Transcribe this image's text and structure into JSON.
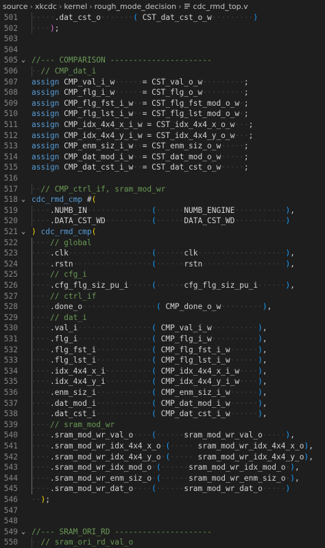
{
  "breadcrumbs": [
    "source",
    "xkcdc",
    "kernel",
    "rough_mode_decision",
    "cdc_rmd_top.v"
  ],
  "colors": {
    "background": "#1e1e1e",
    "keyword": "#569cd6",
    "comment": "#6a9955",
    "line_number": "#858585",
    "bracket_gold": "#ffd700",
    "bracket_purple": "#da70d6",
    "bracket_blue": "#179fff"
  },
  "lines": [
    {
      "n": "501",
      "fold": "",
      "tokens": [
        [
          "ws",
          "·····"
        ],
        [
          "pn",
          ".dat_cst_o"
        ],
        [
          "ws",
          "·······"
        ],
        [
          "br3",
          "("
        ],
        [
          "pn",
          " CST_dat_cst_o_w"
        ],
        [
          "ws",
          "·········"
        ],
        [
          "br3",
          ")"
        ]
      ]
    },
    {
      "n": "502",
      "fold": "",
      "tokens": [
        [
          "ws",
          "····"
        ],
        [
          "br2",
          ")"
        ],
        [
          "pn",
          ";"
        ]
      ]
    },
    {
      "n": "503",
      "fold": "",
      "tokens": []
    },
    {
      "n": "504",
      "fold": "",
      "tokens": []
    },
    {
      "n": "505",
      "fold": "⌄",
      "tokens": [
        [
          "cm",
          "//--- COMPARISON ----------------------"
        ]
      ]
    },
    {
      "n": "506",
      "fold": "",
      "tokens": [
        [
          "ws",
          "··"
        ],
        [
          "cm",
          "// CMP_dat_i"
        ]
      ]
    },
    {
      "n": "507",
      "fold": "",
      "tokens": [
        [
          "kw",
          "assign"
        ],
        [
          "pn",
          " CMP_val_i_w"
        ],
        [
          "ws",
          "······"
        ],
        [
          "pn",
          "= CST_val_o_w"
        ],
        [
          "ws",
          "·········"
        ],
        [
          "pn",
          ";"
        ]
      ]
    },
    {
      "n": "508",
      "fold": "",
      "tokens": [
        [
          "kw",
          "assign"
        ],
        [
          "pn",
          " CMP_flg_i_w"
        ],
        [
          "ws",
          "······"
        ],
        [
          "pn",
          "= CST_flg_o_w"
        ],
        [
          "ws",
          "·········"
        ],
        [
          "pn",
          ";"
        ]
      ]
    },
    {
      "n": "509",
      "fold": "",
      "tokens": [
        [
          "kw",
          "assign"
        ],
        [
          "pn",
          " CMP_flg_fst_i_w"
        ],
        [
          "ws",
          "··"
        ],
        [
          "pn",
          "= CST_flg_fst_mod_o_w"
        ],
        [
          "ws",
          "·"
        ],
        [
          "pn",
          ";"
        ]
      ]
    },
    {
      "n": "510",
      "fold": "",
      "tokens": [
        [
          "kw",
          "assign"
        ],
        [
          "pn",
          " CMP_flg_lst_i_w"
        ],
        [
          "ws",
          "··"
        ],
        [
          "pn",
          "= CST_flg_lst_mod_o_w"
        ],
        [
          "ws",
          "·"
        ],
        [
          "pn",
          ";"
        ]
      ]
    },
    {
      "n": "511",
      "fold": "",
      "tokens": [
        [
          "kw",
          "assign"
        ],
        [
          "pn",
          " CMP_idx_4x4_x_i_w"
        ],
        [
          "pn",
          " = CST_idx_4x4_x_o_w"
        ],
        [
          "ws",
          "···"
        ],
        [
          "pn",
          ";"
        ]
      ]
    },
    {
      "n": "512",
      "fold": "",
      "tokens": [
        [
          "kw",
          "assign"
        ],
        [
          "pn",
          " CMP_idx_4x4_y_i_w"
        ],
        [
          "pn",
          " = CST_idx_4x4_y_o_w"
        ],
        [
          "ws",
          "···"
        ],
        [
          "pn",
          ";"
        ]
      ]
    },
    {
      "n": "513",
      "fold": "",
      "tokens": [
        [
          "kw",
          "assign"
        ],
        [
          "pn",
          " CMP_enm_siz_i_w"
        ],
        [
          "ws",
          "··"
        ],
        [
          "pn",
          "= CST_enm_siz_o_w"
        ],
        [
          "ws",
          "·····"
        ],
        [
          "pn",
          ";"
        ]
      ]
    },
    {
      "n": "514",
      "fold": "",
      "tokens": [
        [
          "kw",
          "assign"
        ],
        [
          "pn",
          " CMP_dat_mod_i_w"
        ],
        [
          "ws",
          "··"
        ],
        [
          "pn",
          "= CST_dat_mod_o_w"
        ],
        [
          "ws",
          "·····"
        ],
        [
          "pn",
          ";"
        ]
      ]
    },
    {
      "n": "515",
      "fold": "",
      "tokens": [
        [
          "kw",
          "assign"
        ],
        [
          "pn",
          " CMP_dat_cst_i_w"
        ],
        [
          "ws",
          "··"
        ],
        [
          "pn",
          "= CST_dat_cst_o_w"
        ],
        [
          "ws",
          "·····"
        ],
        [
          "pn",
          ";"
        ]
      ]
    },
    {
      "n": "516",
      "fold": "",
      "tokens": []
    },
    {
      "n": "517",
      "fold": "",
      "tokens": [
        [
          "ws",
          "··"
        ],
        [
          "cm",
          "// CMP_ctrl_if, sram_mod_wr"
        ]
      ]
    },
    {
      "n": "518",
      "fold": "⌄",
      "tokens": [
        [
          "kw",
          "cdc_rmd_cmp"
        ],
        [
          "pn",
          " #"
        ],
        [
          "br",
          "("
        ]
      ]
    },
    {
      "n": "519",
      "fold": "",
      "tokens": [
        [
          "ws",
          "····"
        ],
        [
          "pn",
          ".NUMB_IN"
        ],
        [
          "ws",
          "··············"
        ],
        [
          "br3",
          "("
        ],
        [
          "ws",
          "······"
        ],
        [
          "pn",
          "NUMB_ENGINE"
        ],
        [
          "ws",
          "···········"
        ],
        [
          "br3",
          ")"
        ],
        [
          "pn",
          ","
        ]
      ]
    },
    {
      "n": "520",
      "fold": "",
      "tokens": [
        [
          "ws",
          "····"
        ],
        [
          "pn",
          ".DATA_CST_WD"
        ],
        [
          "ws",
          "··········"
        ],
        [
          "br3",
          "("
        ],
        [
          "ws",
          "······"
        ],
        [
          "pn",
          "DATA_CST_WD"
        ],
        [
          "ws",
          "···········"
        ],
        [
          "br3",
          ")"
        ]
      ]
    },
    {
      "n": "521",
      "fold": "⌄",
      "tokens": [
        [
          "br",
          ")"
        ],
        [
          "kw",
          " cdc_rmd_cmp"
        ],
        [
          "br",
          "("
        ]
      ]
    },
    {
      "n": "522",
      "fold": "",
      "tokens": [
        [
          "ws",
          "····"
        ],
        [
          "cm",
          "// global"
        ]
      ]
    },
    {
      "n": "523",
      "fold": "",
      "tokens": [
        [
          "ws",
          "····"
        ],
        [
          "pn",
          ".clk"
        ],
        [
          "ws",
          "··················"
        ],
        [
          "br3",
          "("
        ],
        [
          "ws",
          "······"
        ],
        [
          "pn",
          "clk"
        ],
        [
          "ws",
          "···················"
        ],
        [
          "br3",
          ")"
        ],
        [
          "pn",
          ","
        ]
      ]
    },
    {
      "n": "524",
      "fold": "",
      "tokens": [
        [
          "ws",
          "····"
        ],
        [
          "pn",
          ".rstn"
        ],
        [
          "ws",
          "·················"
        ],
        [
          "br3",
          "("
        ],
        [
          "ws",
          "······"
        ],
        [
          "pn",
          "rstn"
        ],
        [
          "ws",
          "··················"
        ],
        [
          "br3",
          ")"
        ],
        [
          "pn",
          ","
        ]
      ]
    },
    {
      "n": "525",
      "fold": "",
      "tokens": [
        [
          "ws",
          "····"
        ],
        [
          "cm",
          "// cfg_i"
        ]
      ]
    },
    {
      "n": "526",
      "fold": "",
      "tokens": [
        [
          "ws",
          "····"
        ],
        [
          "pn",
          ".cfg_flg_siz_pu_i"
        ],
        [
          "ws",
          "·····"
        ],
        [
          "br3",
          "("
        ],
        [
          "ws",
          "······"
        ],
        [
          "pn",
          "cfg_flg_siz_pu_i"
        ],
        [
          "ws",
          "······"
        ],
        [
          "br3",
          ")"
        ],
        [
          "pn",
          ","
        ]
      ]
    },
    {
      "n": "527",
      "fold": "",
      "tokens": [
        [
          "ws",
          "····"
        ],
        [
          "cm",
          "// ctrl_if"
        ]
      ]
    },
    {
      "n": "528",
      "fold": "",
      "tokens": [
        [
          "ws",
          "····"
        ],
        [
          "pn",
          ".done_o"
        ],
        [
          "ws",
          "················"
        ],
        [
          "br3",
          "("
        ],
        [
          "pn",
          " CMP_done_o_w"
        ],
        [
          "ws",
          "·········"
        ],
        [
          "br3",
          ")"
        ],
        [
          "pn",
          ","
        ]
      ]
    },
    {
      "n": "529",
      "fold": "",
      "tokens": [
        [
          "ws",
          "····"
        ],
        [
          "cm",
          "// dat_i"
        ]
      ]
    },
    {
      "n": "530",
      "fold": "",
      "tokens": [
        [
          "ws",
          "····"
        ],
        [
          "pn",
          ".val_i"
        ],
        [
          "ws",
          "················"
        ],
        [
          "br3",
          "("
        ],
        [
          "pn",
          " CMP_val_i_w"
        ],
        [
          "ws",
          "··········"
        ],
        [
          "br3",
          ")"
        ],
        [
          "pn",
          ","
        ]
      ]
    },
    {
      "n": "531",
      "fold": "",
      "tokens": [
        [
          "ws",
          "····"
        ],
        [
          "pn",
          ".flg_i"
        ],
        [
          "ws",
          "················"
        ],
        [
          "br3",
          "("
        ],
        [
          "pn",
          " CMP_flg_i_w"
        ],
        [
          "ws",
          "··········"
        ],
        [
          "br3",
          ")"
        ],
        [
          "pn",
          ","
        ]
      ]
    },
    {
      "n": "532",
      "fold": "",
      "tokens": [
        [
          "ws",
          "····"
        ],
        [
          "pn",
          ".flg_fst_i"
        ],
        [
          "ws",
          "············"
        ],
        [
          "br3",
          "("
        ],
        [
          "pn",
          " CMP_flg_fst_i_w"
        ],
        [
          "ws",
          "······"
        ],
        [
          "br3",
          ")"
        ],
        [
          "pn",
          ","
        ]
      ]
    },
    {
      "n": "533",
      "fold": "",
      "tokens": [
        [
          "ws",
          "····"
        ],
        [
          "pn",
          ".flg_lst_i"
        ],
        [
          "ws",
          "············"
        ],
        [
          "br3",
          "("
        ],
        [
          "pn",
          " CMP_flg_lst_i_w"
        ],
        [
          "ws",
          "······"
        ],
        [
          "br3",
          ")"
        ],
        [
          "pn",
          ","
        ]
      ]
    },
    {
      "n": "534",
      "fold": "",
      "tokens": [
        [
          "ws",
          "····"
        ],
        [
          "pn",
          ".idx_4x4_x_i"
        ],
        [
          "ws",
          "··········"
        ],
        [
          "br3",
          "("
        ],
        [
          "pn",
          " CMP_idx_4x4_x_i_w"
        ],
        [
          "ws",
          "····"
        ],
        [
          "br3",
          ")"
        ],
        [
          "pn",
          ","
        ]
      ]
    },
    {
      "n": "535",
      "fold": "",
      "tokens": [
        [
          "ws",
          "····"
        ],
        [
          "pn",
          ".idx_4x4_y_i"
        ],
        [
          "ws",
          "··········"
        ],
        [
          "br3",
          "("
        ],
        [
          "pn",
          " CMP_idx_4x4_y_i_w"
        ],
        [
          "ws",
          "····"
        ],
        [
          "br3",
          ")"
        ],
        [
          "pn",
          ","
        ]
      ]
    },
    {
      "n": "536",
      "fold": "",
      "tokens": [
        [
          "ws",
          "····"
        ],
        [
          "pn",
          ".enm_siz_i"
        ],
        [
          "ws",
          "············"
        ],
        [
          "br3",
          "("
        ],
        [
          "pn",
          " CMP_enm_siz_i_w"
        ],
        [
          "ws",
          "······"
        ],
        [
          "br3",
          ")"
        ],
        [
          "pn",
          ","
        ]
      ]
    },
    {
      "n": "537",
      "fold": "",
      "tokens": [
        [
          "ws",
          "····"
        ],
        [
          "pn",
          ".dat_mod_i"
        ],
        [
          "ws",
          "············"
        ],
        [
          "br3",
          "("
        ],
        [
          "pn",
          " CMP_dat_mod_i_w"
        ],
        [
          "ws",
          "······"
        ],
        [
          "br3",
          ")"
        ],
        [
          "pn",
          ","
        ]
      ]
    },
    {
      "n": "538",
      "fold": "",
      "tokens": [
        [
          "ws",
          "····"
        ],
        [
          "pn",
          ".dat_cst_i"
        ],
        [
          "ws",
          "············"
        ],
        [
          "br3",
          "("
        ],
        [
          "pn",
          " CMP_dat_cst_i_w"
        ],
        [
          "ws",
          "······"
        ],
        [
          "br3",
          ")"
        ],
        [
          "pn",
          ","
        ]
      ]
    },
    {
      "n": "539",
      "fold": "",
      "tokens": [
        [
          "ws",
          "····"
        ],
        [
          "cm",
          "// sram_mod_wr"
        ]
      ]
    },
    {
      "n": "540",
      "fold": "",
      "tokens": [
        [
          "ws",
          "····"
        ],
        [
          "pn",
          ".sram_mod_wr_val_o"
        ],
        [
          "ws",
          "····"
        ],
        [
          "br3",
          "("
        ],
        [
          "ws",
          "······"
        ],
        [
          "pn",
          "sram_mod_wr_val_o"
        ],
        [
          "ws",
          "·····"
        ],
        [
          "br3",
          ")"
        ],
        [
          "pn",
          ","
        ]
      ]
    },
    {
      "n": "541",
      "fold": "",
      "tokens": [
        [
          "ws",
          "····"
        ],
        [
          "pn",
          ".sram_mod_wr_idx_4x4_x_o"
        ],
        [
          "ws",
          "·"
        ],
        [
          "br3",
          "("
        ],
        [
          "ws",
          "·····"
        ],
        [
          "pn",
          " sram_mod_wr_idx_4x4_x_o"
        ],
        [
          "br3",
          ")"
        ],
        [
          "pn",
          ","
        ]
      ]
    },
    {
      "n": "542",
      "fold": "",
      "tokens": [
        [
          "ws",
          "····"
        ],
        [
          "pn",
          ".sram_mod_wr_idx_4x4_y_o"
        ],
        [
          "ws",
          "·"
        ],
        [
          "br3",
          "("
        ],
        [
          "ws",
          "·····"
        ],
        [
          "pn",
          " sram_mod_wr_idx_4x4_y_o"
        ],
        [
          "br3",
          ")"
        ],
        [
          "pn",
          ","
        ]
      ]
    },
    {
      "n": "543",
      "fold": "",
      "tokens": [
        [
          "ws",
          "····"
        ],
        [
          "pn",
          ".sram_mod_wr_idx_mod_o"
        ],
        [
          "ws",
          "·"
        ],
        [
          "br3",
          "("
        ],
        [
          "ws",
          "······"
        ],
        [
          "pn",
          "sram_mod_wr_idx_mod_o"
        ],
        [
          "ws",
          "·"
        ],
        [
          "br3",
          ")"
        ],
        [
          "pn",
          ","
        ]
      ]
    },
    {
      "n": "544",
      "fold": "",
      "tokens": [
        [
          "ws",
          "····"
        ],
        [
          "pn",
          ".sram_mod_wr_enm_siz_o"
        ],
        [
          "ws",
          "·"
        ],
        [
          "br3",
          "("
        ],
        [
          "ws",
          "······"
        ],
        [
          "pn",
          "sram_mod_wr_enm_siz_o"
        ],
        [
          "ws",
          "·"
        ],
        [
          "br3",
          ")"
        ],
        [
          "pn",
          ","
        ]
      ]
    },
    {
      "n": "545",
      "fold": "",
      "tokens": [
        [
          "ws",
          "····"
        ],
        [
          "pn",
          ".sram_mod_wr_dat_o"
        ],
        [
          "ws",
          "····"
        ],
        [
          "br3",
          "("
        ],
        [
          "ws",
          "······"
        ],
        [
          "pn",
          "sram_mod_wr_dat_o"
        ],
        [
          "ws",
          "·····"
        ],
        [
          "br3",
          ")"
        ]
      ]
    },
    {
      "n": "546",
      "fold": "",
      "tokens": [
        [
          "ws",
          "··"
        ],
        [
          "br",
          ")"
        ],
        [
          "pn",
          ";"
        ]
      ]
    },
    {
      "n": "547",
      "fold": "",
      "tokens": []
    },
    {
      "n": "548",
      "fold": "",
      "tokens": []
    },
    {
      "n": "549",
      "fold": "⌄",
      "tokens": [
        [
          "cm",
          "//--- SRAM_ORI_RD ---------------------"
        ]
      ]
    },
    {
      "n": "550",
      "fold": "",
      "tokens": [
        [
          "ws",
          "··"
        ],
        [
          "cm",
          "// sram_ori_rd_val_o"
        ]
      ]
    }
  ]
}
